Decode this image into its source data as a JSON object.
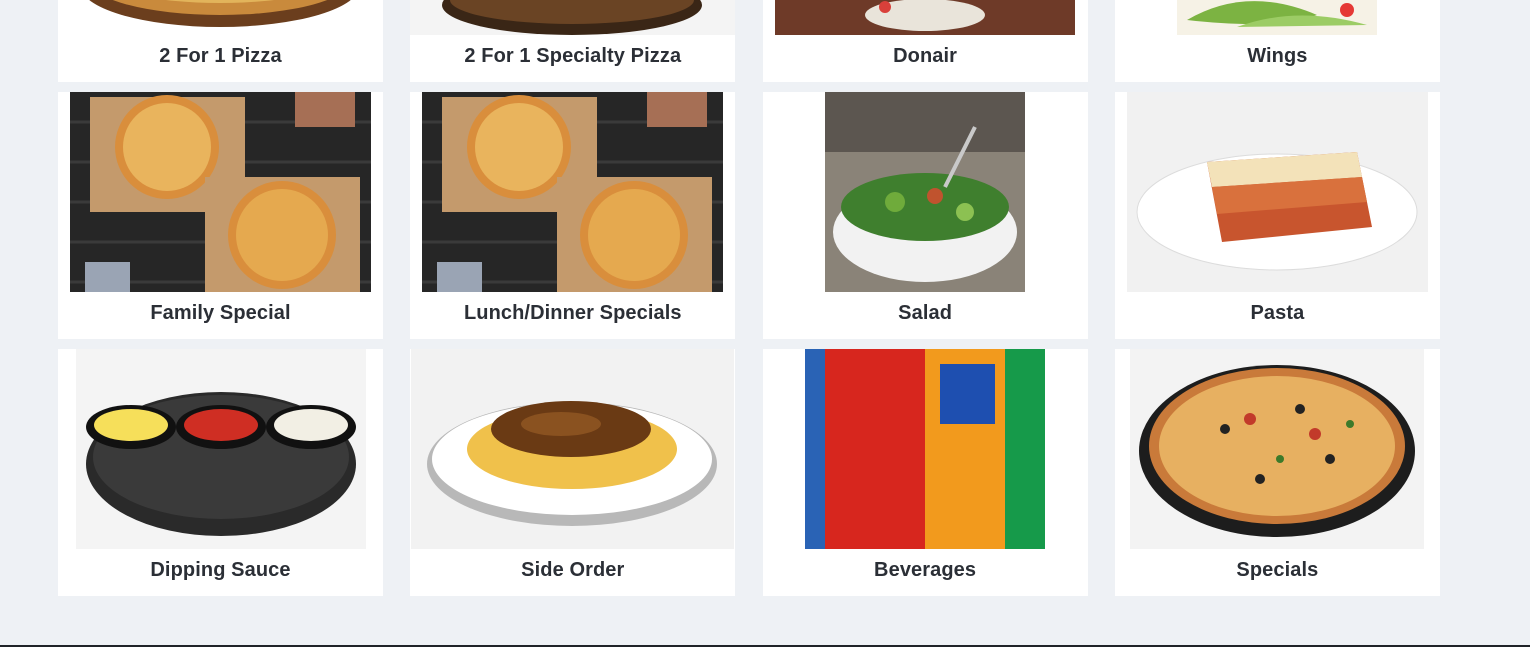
{
  "menu": {
    "categories": [
      {
        "label": "2 For 1 Pizza",
        "image": "pizza-on-board-image"
      },
      {
        "label": "2 For 1 Specialty Pizza",
        "image": "specialty-pizza-image"
      },
      {
        "label": "Donair",
        "image": "donair-image"
      },
      {
        "label": "Wings",
        "image": "wings-image"
      },
      {
        "label": "Family Special",
        "image": "family-pizzas-image"
      },
      {
        "label": "Lunch/Dinner Specials",
        "image": "two-pizzas-image"
      },
      {
        "label": "Salad",
        "image": "salad-bowl-image"
      },
      {
        "label": "Pasta",
        "image": "lasagna-image"
      },
      {
        "label": "Dipping Sauce",
        "image": "dipping-sauces-image"
      },
      {
        "label": "Side Order",
        "image": "poutine-image"
      },
      {
        "label": "Beverages",
        "image": "soda-cans-image"
      },
      {
        "label": "Specials",
        "image": "specials-pizza-image"
      }
    ]
  },
  "colors": {
    "page_background": "#eef1f5",
    "card_background": "#ffffff",
    "label_text": "#2b2f36"
  }
}
